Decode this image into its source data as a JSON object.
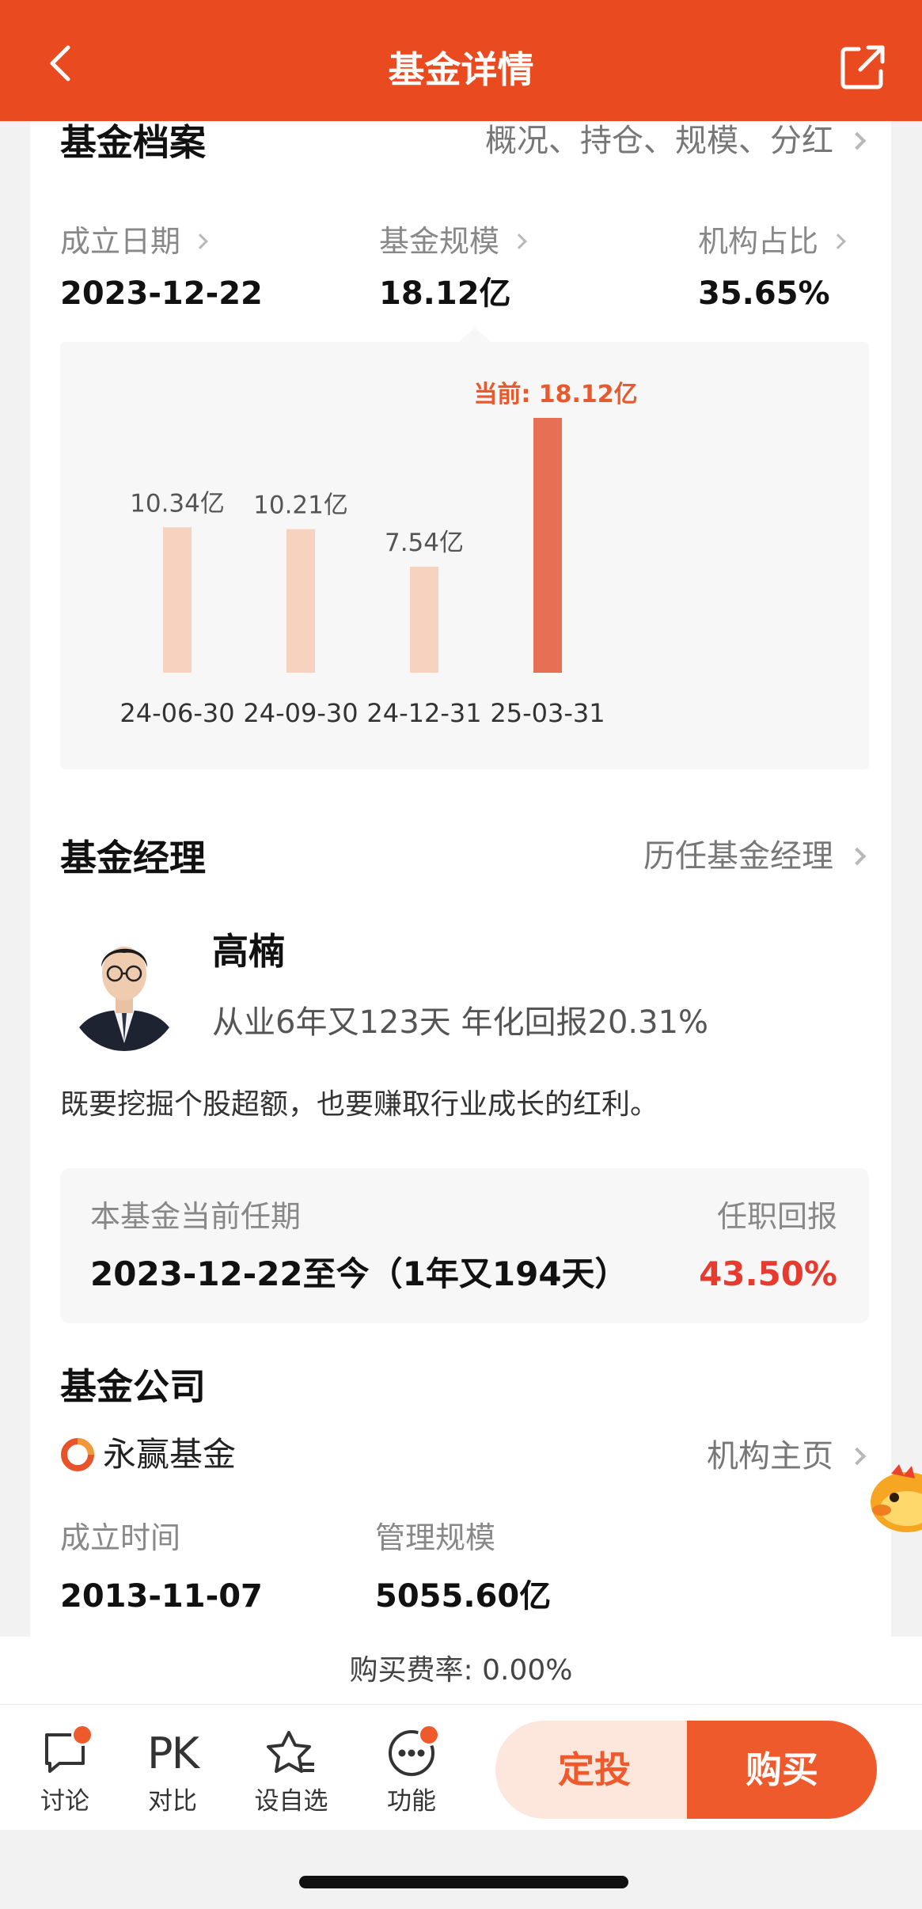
{
  "header": {
    "title": "基金详情"
  },
  "profile": {
    "title": "基金档案",
    "link": "概况、持仓、规模、分红",
    "stats": [
      {
        "label": "成立日期",
        "value": "2023-12-22"
      },
      {
        "label": "基金规模",
        "value": "18.12亿"
      },
      {
        "label": "机构占比",
        "value": "35.65%"
      }
    ]
  },
  "chart_data": {
    "type": "bar",
    "categories": [
      "24-06-30",
      "24-09-30",
      "24-12-31",
      "25-03-31"
    ],
    "values": [
      10.34,
      10.21,
      7.54,
      18.12
    ],
    "data_labels": [
      "10.34亿",
      "10.21亿",
      "7.54亿",
      "当前: 18.12亿"
    ],
    "unit": "亿",
    "ylim": [
      0,
      18.12
    ],
    "colors": {
      "past": "#f6d2bf",
      "current": "#e66f54",
      "current_label": "#e65a2e"
    },
    "grid": false,
    "legend": "none"
  },
  "manager": {
    "title": "基金经理",
    "link": "历任基金经理",
    "name": "高楠",
    "stats": "从业6年又123天 年化回报20.31%",
    "quote": "既要挖掘个股超额，也要赚取行业成长的红利。",
    "tenure_label": "本基金当前任期",
    "tenure_value": "2023-12-22至今（1年又194天）",
    "return_label": "任职回报",
    "return_value": "43.50%"
  },
  "company": {
    "title": "基金公司",
    "name": "永赢基金",
    "link": "机构主页",
    "founded_label": "成立时间",
    "founded_value": "2013-11-07",
    "aum_label": "管理规模",
    "aum_value": "5055.60亿"
  },
  "fee": "购买费率: 0.00%",
  "toolbar": {
    "discuss": "讨论",
    "compare_icon": "PK",
    "compare": "对比",
    "watchlist": "设自选",
    "functions": "功能",
    "dingtou": "定投",
    "buy": "购买"
  },
  "colors": {
    "brand": "#ea4a1f",
    "accent": "#ee5a2c",
    "positive": "#e63b2e"
  }
}
